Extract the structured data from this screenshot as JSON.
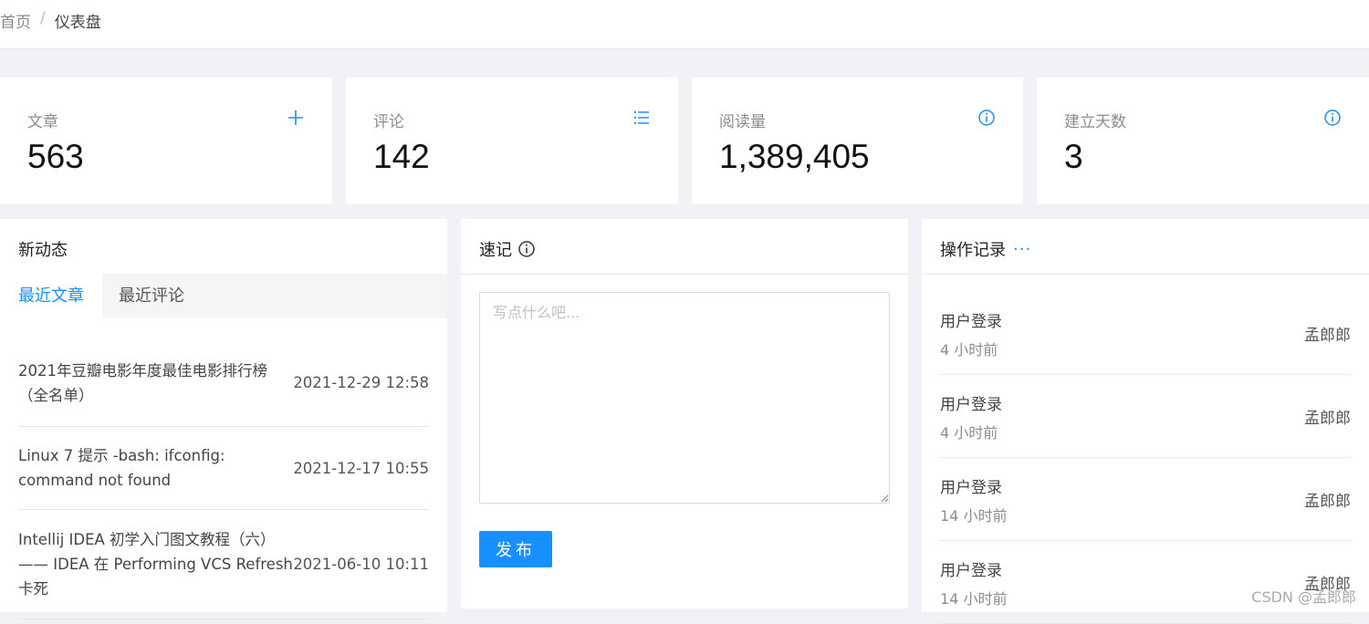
{
  "breadcrumb": {
    "home": "首页",
    "separator": "/",
    "current": "仪表盘"
  },
  "stats": [
    {
      "label": "文章",
      "value": "563",
      "icon": "plus-icon"
    },
    {
      "label": "评论",
      "value": "142",
      "icon": "list-icon"
    },
    {
      "label": "阅读量",
      "value": "1,389,405",
      "icon": "info-circle-icon"
    },
    {
      "label": "建立天数",
      "value": "3",
      "icon": "info-circle-icon"
    }
  ],
  "activity": {
    "title": "新动态",
    "tabs": [
      "最近文章",
      "最近评论"
    ],
    "posts": [
      {
        "title": "2021年豆瓣电影年度最佳电影排行榜（全名单）",
        "date": "2021-12-29 12:58"
      },
      {
        "title": "Linux 7 提示 -bash: ifconfig: command not found",
        "date": "2021-12-17 10:55"
      },
      {
        "title": "Intellij IDEA 初学入门图文教程（六）—— IDEA 在 Performing VCS Refresh 卡死",
        "date": "2021-06-10 10:11"
      }
    ]
  },
  "notes": {
    "title": "速记",
    "placeholder": "写点什么吧...",
    "publish_label": "发布"
  },
  "logs": {
    "title": "操作记录",
    "more": "···",
    "items": [
      {
        "action": "用户登录",
        "time": "4 小时前",
        "user": "孟郎郎"
      },
      {
        "action": "用户登录",
        "time": "4 小时前",
        "user": "孟郎郎"
      },
      {
        "action": "用户登录",
        "time": "14 小时前",
        "user": "孟郎郎"
      },
      {
        "action": "用户登录",
        "time": "14 小时前",
        "user": "孟郎郎"
      }
    ]
  },
  "watermark": "CSDN @孟郎郎",
  "colors": {
    "accent": "#1890ff",
    "background": "#f0f2f5"
  }
}
